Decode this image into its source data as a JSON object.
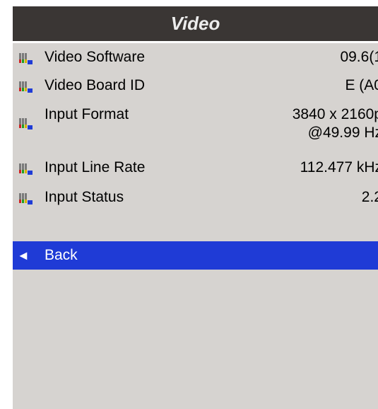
{
  "window": {
    "title": "Video"
  },
  "rows": [
    {
      "label": "Video Software",
      "value": "09.6(1",
      "icon": "video-connector-icon"
    },
    {
      "label": "Video Board ID",
      "value": "E (A0",
      "icon": "video-connector-icon"
    },
    {
      "label": "Input Format",
      "value_line1": "3840 x 2160p",
      "value_line2": "@49.99 Hz",
      "icon": "video-connector-icon"
    },
    {
      "label": "Input Line Rate",
      "value": "112.477 kHz",
      "icon": "video-connector-icon"
    },
    {
      "label": "Input Status",
      "value": "2.2",
      "icon": "video-connector-icon"
    }
  ],
  "back": {
    "arrow": "◄",
    "label": "Back"
  },
  "colors": {
    "title_bg": "#3a3634",
    "panel_bg": "#d6d3d0",
    "selected_bg": "#1f3bd6"
  }
}
